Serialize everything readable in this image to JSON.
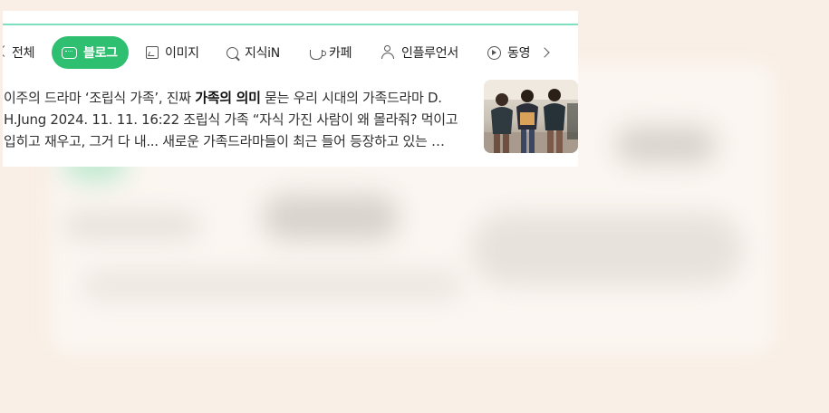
{
  "tabs": {
    "all": "전체",
    "blog": "블로그",
    "image": "이미지",
    "kin": "지식iN",
    "cafe": "카페",
    "influencer": "인플루언서",
    "video": "동영"
  },
  "result": {
    "text_before": "이주의 드라마 ‘조립식 가족’, 진짜 ",
    "highlight": "가족의 의미",
    "text_after": " 묻는 우리 시대의 가족드라마 D. H.Jung 2024. 11. 11. 16:22 조립식 가족 “자식 가진 사람이 왜 몰라줘? 먹이고 입히고 재우고, 그거 다 내... 새로운 가족드라마들이 최근 들어 등장하고 있는 …"
  },
  "colors": {
    "accent": "#2fbf71",
    "topline": "#7fe0bf",
    "background": "#f9efe6"
  }
}
